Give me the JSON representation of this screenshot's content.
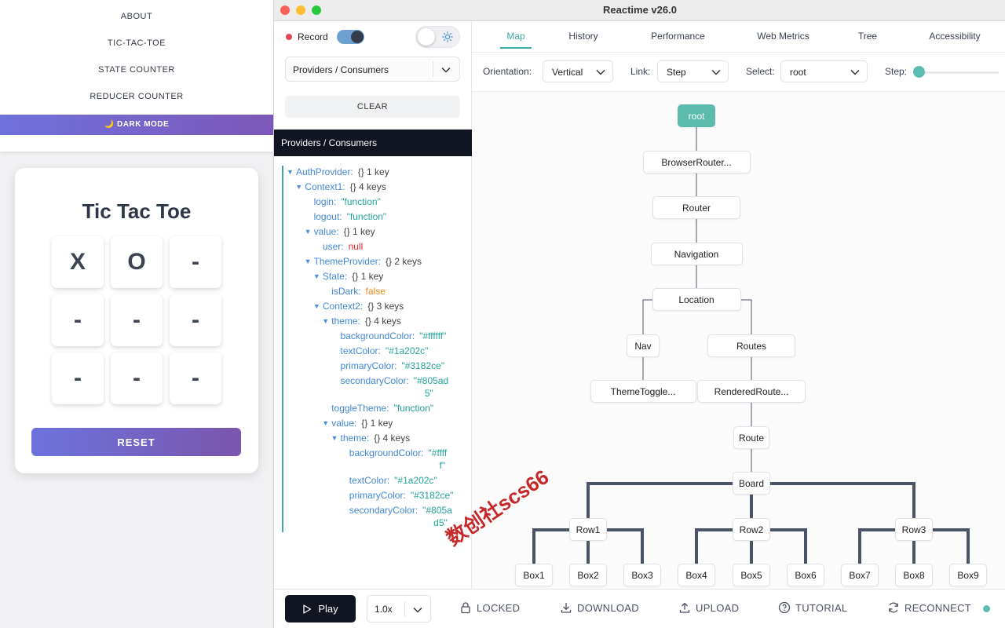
{
  "host": {
    "nav": [
      "ABOUT",
      "TIC-TAC-TOE",
      "STATE COUNTER",
      "REDUCER COUNTER"
    ],
    "dark_mode": "🌙 DARK MODE",
    "game": {
      "title": "Tic Tac Toe",
      "cells": [
        "X",
        "O",
        "-",
        "-",
        "-",
        "-",
        "-",
        "-",
        "-"
      ],
      "reset": "RESET"
    }
  },
  "window": {
    "title": "Reactime v26.0"
  },
  "sidebar": {
    "record_label": "Record",
    "view_select": "Providers / Consumers",
    "clear": "CLEAR",
    "section_title": "Providers / Consumers",
    "tree": [
      {
        "key": "AuthProvider:",
        "meta": "{} 1 key",
        "kind": "meta",
        "expanded": true
      },
      {
        "key": "Context1:",
        "meta": "{} 4 keys",
        "kind": "meta",
        "expanded": true
      },
      {
        "key": "login:",
        "value": "\"function\"",
        "kind": "str"
      },
      {
        "key": "logout:",
        "value": "\"function\"",
        "kind": "str"
      },
      {
        "key": "value:",
        "meta": "{} 1 key",
        "kind": "meta",
        "expanded": true
      },
      {
        "key": "user:",
        "value": "null",
        "kind": "null"
      },
      {
        "key": "ThemeProvider:",
        "meta": "{} 2 keys",
        "kind": "meta",
        "expanded": true
      },
      {
        "key": "State:",
        "meta": "{} 1 key",
        "kind": "meta",
        "expanded": true
      },
      {
        "key": "isDark:",
        "value": "false",
        "kind": "bool"
      },
      {
        "key": "Context2:",
        "meta": "{} 3 keys",
        "kind": "meta",
        "expanded": true
      },
      {
        "key": "theme:",
        "meta": "{} 4 keys",
        "kind": "meta",
        "expanded": true
      },
      {
        "key": "backgroundColor:",
        "value": "\"#ffffff\"",
        "kind": "str"
      },
      {
        "key": "textColor:",
        "value": "\"#1a202c\"",
        "kind": "str"
      },
      {
        "key": "primaryColor:",
        "value": "\"#3182ce\"",
        "kind": "str"
      },
      {
        "key": "secondaryColor:",
        "value": "\"#805ad",
        "cont": "5\"",
        "kind": "str"
      },
      {
        "key": "toggleTheme:",
        "value": "\"function\"",
        "kind": "str"
      },
      {
        "key": "value:",
        "meta": "{} 1 key",
        "kind": "meta",
        "expanded": true
      },
      {
        "key": "theme:",
        "meta": "{} 4 keys",
        "kind": "meta",
        "expanded": true
      },
      {
        "key": "backgroundColor:",
        "value": "\"#ffff",
        "cont": "f\"",
        "kind": "str"
      },
      {
        "key": "textColor:",
        "value": "\"#1a202c\"",
        "kind": "str"
      },
      {
        "key": "primaryColor:",
        "value": "\"#3182ce\"",
        "kind": "str"
      },
      {
        "key": "secondaryColor:",
        "value": "\"#805a",
        "cont": "d5\"",
        "kind": "str"
      }
    ]
  },
  "tabs": [
    "Map",
    "History",
    "Performance",
    "Web Metrics",
    "Tree",
    "Accessibility"
  ],
  "active_tab": "Map",
  "controls": {
    "orientation_label": "Orientation:",
    "orientation_value": "Vertical",
    "link_label": "Link:",
    "link_value": "Step",
    "select_label": "Select:",
    "select_value": "root",
    "step_label": "Step:",
    "step_fraction": 0
  },
  "map_nodes": [
    "root",
    "BrowserRouter...",
    "Router",
    "Navigation",
    "Location",
    "Nav",
    "Routes",
    "ThemeToggle...",
    "RenderedRoute...",
    "Route",
    "Board",
    "Row1",
    "Row2",
    "Row3",
    "Box1",
    "Box2",
    "Box3",
    "Box4",
    "Box5",
    "Box6",
    "Box7",
    "Box8",
    "Box9"
  ],
  "footer": {
    "play": "Play",
    "speed": "1.0x",
    "locked": "LOCKED",
    "download": "DOWNLOAD",
    "upload": "UPLOAD",
    "tutorial": "TUTORIAL",
    "reconnect": "RECONNECT"
  },
  "watermark": "数创社scs66",
  "colors": {
    "accent": "#3da9a1",
    "root_node": "#5bbcae",
    "purple_gradient_start": "#6d73dc",
    "purple_gradient_end": "#7a55ad"
  }
}
